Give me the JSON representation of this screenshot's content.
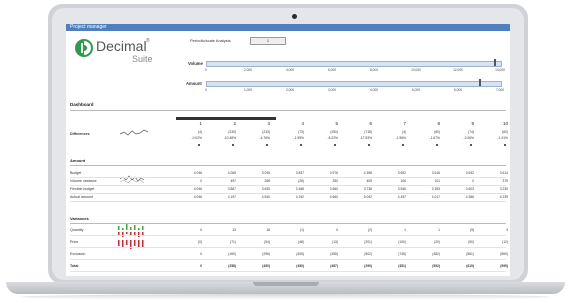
{
  "window": {
    "title": "Project manager"
  },
  "brand": {
    "name": "Decimal",
    "suffix": "Suite",
    "mark": "®"
  },
  "sensitivity": {
    "label": "Periodic/scale Analysis",
    "value": "1"
  },
  "volume": {
    "label": "Volume",
    "ticks": [
      "0",
      "2,000",
      "4,000",
      "6,000",
      "8,000",
      "10,000",
      "12,000",
      "14,000"
    ],
    "level": 0.98
  },
  "amount": {
    "label": "Amount",
    "ticks": [
      "0",
      "1,000",
      "2,000",
      "3,000",
      "4,000",
      "5,000",
      "6,000",
      "7,000"
    ],
    "level": 0.93
  },
  "dashboard": {
    "title": "Dashboard"
  },
  "columns": [
    "1",
    "2",
    "3",
    "4",
    "5",
    "6",
    "7",
    "8",
    "9",
    "10"
  ],
  "differences": {
    "label": "Differences",
    "values": [
      "(4)",
      "(230)",
      "(233)",
      "(73)",
      "(250)",
      "(718)",
      "(4)",
      "(60)",
      "(74)",
      "(60)"
    ],
    "pct": [
      "-0.02%",
      "-10.48%",
      "-4.76%",
      "-1.95%",
      "-6.22%",
      "-17.93%",
      "-1.96%",
      "-1.67%",
      "-2.06%",
      "-1.41%"
    ]
  },
  "amount_section": {
    "title": "Amount"
  },
  "amount_rows": [
    {
      "label": "Budget",
      "values": [
        "4 046",
        "4 065",
        "3 045",
        "3 837",
        "3 976",
        "4 398",
        "3 692",
        "3 616",
        "3 632",
        "3 614"
      ]
    },
    {
      "label": "Volume variance",
      "values": [
        "0",
        "497",
        "268",
        "(26)",
        "250",
        "405",
        "106",
        "101",
        "0",
        "379"
      ]
    },
    {
      "label": "Flexible budget",
      "values": [
        "4 046",
        "3 867",
        "3 630",
        "3 468",
        "3 560",
        "3 738",
        "3 546",
        "3 393",
        "3 603",
        "3 230"
      ]
    },
    {
      "label": "Actual amount",
      "values": [
        "4 046",
        "4 197",
        "4 540",
        "4 192",
        "4 660",
        "5 042",
        "4 497",
        "4 017",
        "4 366",
        "4 239"
      ]
    }
  ],
  "variances": {
    "title": "Variances"
  },
  "variance_rows": [
    {
      "label": "Quantity",
      "values": [
        "0",
        "13",
        "18",
        "(1)",
        "0",
        "(2)",
        "1",
        "1",
        "(5)",
        "3"
      ]
    },
    {
      "label": "Price",
      "values": [
        "(0)",
        "(71)",
        "(54)",
        "(48)",
        "(13)",
        "(201)",
        "(100)",
        "(20)",
        "(50)",
        "(12)"
      ]
    },
    {
      "label": "Exclusion",
      "values": [
        "0",
        "(160)",
        "(296)",
        "(405)",
        "(455)",
        "(502)",
        "(745)",
        "(482)",
        "(561)",
        "(560)"
      ]
    },
    {
      "label": "Total",
      "values": [
        "0",
        "(258)",
        "(450)",
        "(450)",
        "(487)",
        "(290)",
        "(351)",
        "(592)",
        "(619)",
        "(595)"
      ]
    }
  ],
  "colors": {
    "titlebar": "#4f7fbf",
    "logo_green": "#2e9c4a",
    "red": "#d9232e",
    "green": "#3aaa35"
  }
}
